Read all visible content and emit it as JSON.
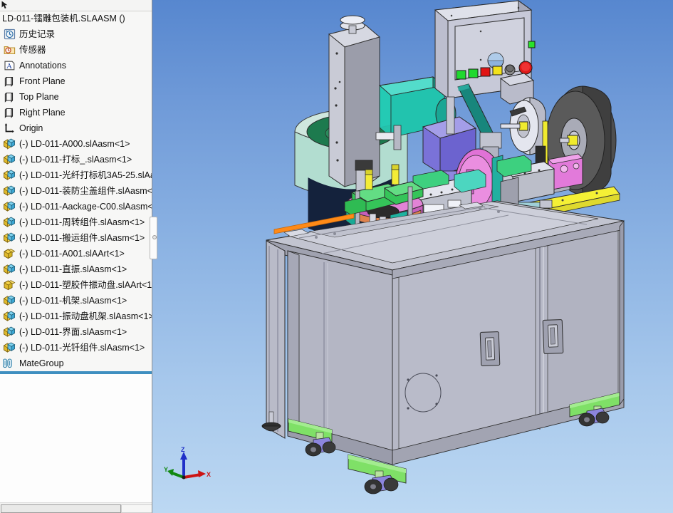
{
  "app": {
    "viewport_background_top": "#5787cf",
    "viewport_background_bottom": "#bcd8f2"
  },
  "tree": {
    "root_label": "LD-011-镭雕包装机.SLAASM  ()",
    "drop_indicator_color": "#3f8fc0",
    "items": [
      {
        "label": "历史记录",
        "icon": "history-icon"
      },
      {
        "label": "传感器",
        "icon": "sensor-folder-icon"
      },
      {
        "label": "Annotations",
        "icon": "annotations-icon"
      },
      {
        "label": "Front Plane",
        "icon": "plane-icon"
      },
      {
        "label": "Top Plane",
        "icon": "plane-icon"
      },
      {
        "label": "Right Plane",
        "icon": "plane-icon"
      },
      {
        "label": "Origin",
        "icon": "origin-icon"
      },
      {
        "label": "(-) LD-011-A000.slAasm<1>",
        "icon": "assembly-icon"
      },
      {
        "label": "(-) LD-011-打标_.slAasm<1>",
        "icon": "assembly-icon"
      },
      {
        "label": "(-) LD-011-光纤打标机3A5-25.slAa",
        "icon": "assembly-icon"
      },
      {
        "label": "(-) LD-011-装防尘盖组件.slAasm<",
        "icon": "assembly-icon"
      },
      {
        "label": "(-) LD-011-Aackage-C00.slAasm<",
        "icon": "assembly-icon"
      },
      {
        "label": "(-) LD-011-周转组件.slAasm<1>",
        "icon": "assembly-icon"
      },
      {
        "label": "(-) LD-011-搬运组件.slAasm<1>",
        "icon": "assembly-icon"
      },
      {
        "label": "(-) LD-011-A001.slAArt<1>",
        "icon": "part-icon"
      },
      {
        "label": "(-) LD-011-直振.slAasm<1>",
        "icon": "assembly-icon"
      },
      {
        "label": "(-) LD-011-塑胶件振动盘.slAArt<1",
        "icon": "part-icon"
      },
      {
        "label": "(-) LD-011-机架.slAasm<1>",
        "icon": "assembly-icon"
      },
      {
        "label": "(-) LD-011-振动盘机架.slAasm<1>",
        "icon": "assembly-icon"
      },
      {
        "label": "(-) LD-011-界面.slAasm<1>",
        "icon": "assembly-icon"
      },
      {
        "label": "(-) LD-011-光钎组件.slAasm<1>",
        "icon": "assembly-icon"
      },
      {
        "label": "MateGroup",
        "icon": "mategroup-icon"
      }
    ]
  },
  "triad": {
    "z_label": "Z",
    "y_label": "Y",
    "x_label": "X",
    "z_color": "#2030c8",
    "y_color": "#118811",
    "x_color": "#cc1414"
  },
  "model": {
    "name": "LD-011 laser marking packaging machine",
    "colors": {
      "frame_gray": "#b6b8c6",
      "panel_gray": "#aeb0be",
      "green_base": "#8ae36a",
      "teal": "#22b8a4",
      "purple": "#7a72d8",
      "magenta": "#e678d8",
      "yellow": "#f4ef3a",
      "orange": "#ff8a17",
      "red_post": "#e2807c",
      "dark_reel": "#5b5b5b",
      "bowl_mint": "#b8ddd2",
      "bowl_green": "#1d7a4e"
    },
    "control_panel": {
      "buttons": [
        "green",
        "green",
        "red",
        "yellow",
        "gray-knob",
        "estop-red"
      ]
    }
  }
}
